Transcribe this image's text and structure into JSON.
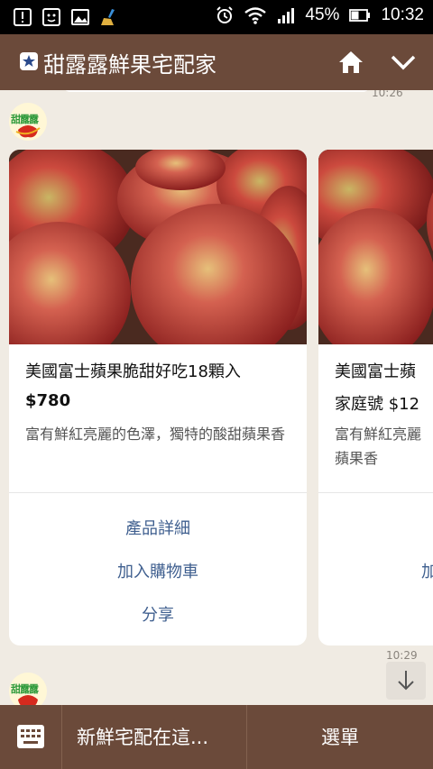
{
  "status_bar": {
    "battery_percent": "45%",
    "time": "10:32",
    "icons_left": [
      "notification-icon",
      "chat-face-icon",
      "image-icon",
      "broom-icon"
    ],
    "icons_right": [
      "alarm-icon",
      "wifi-icon",
      "signal-icon",
      "battery-icon"
    ]
  },
  "header": {
    "title": "甜露露鮮果宅配家",
    "icons": [
      "star-badge-icon",
      "home-icon",
      "chevron-down-icon"
    ]
  },
  "chat": {
    "time_top": "10:26",
    "time_bottom": "10:29",
    "avatar_text": "甜露露",
    "cards": [
      {
        "name": "美國富士蘋果脆甜好吃18顆入",
        "price": "$780",
        "desc": "富有鮮紅亮麗的色澤，獨特的酸甜蘋果香",
        "actions": [
          "產品詳細",
          "加入購物車",
          "分享"
        ]
      },
      {
        "name": "美國富士蘋",
        "price": "家庭號 $12",
        "desc": "富有鮮紅亮麗蘋果香",
        "actions": [
          "",
          "加",
          ""
        ]
      }
    ]
  },
  "bottom_bar": {
    "text_menu": "新鮮宅配在這...",
    "menu_label": "選單"
  },
  "colors": {
    "header_brown": "#6b4a3a",
    "chat_background": "#f0ebe3",
    "action_blue": "#3f5f8f"
  }
}
